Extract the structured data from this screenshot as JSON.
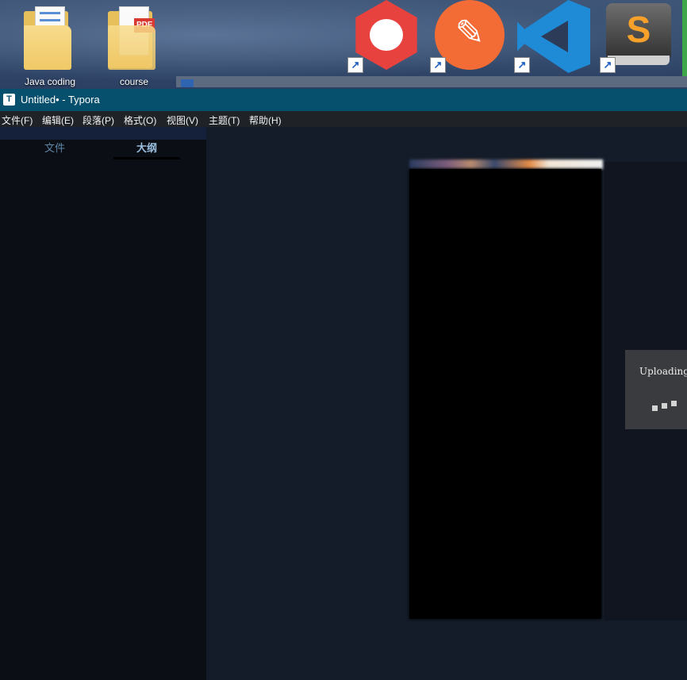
{
  "desktop": {
    "icons": [
      {
        "label": "Java coding"
      },
      {
        "label": "course",
        "badge": "PDF"
      }
    ],
    "apps": [
      "a-hexagon-app-icon",
      "postman-icon",
      "vscode-icon",
      "sublime-text-icon"
    ]
  },
  "window": {
    "app_icon": "T",
    "title": "Untitled• - Typora"
  },
  "menu": [
    "文件(F)",
    "编辑(E)",
    "段落(P)",
    "格式(O)",
    "视图(V)",
    "主题(T)",
    "帮助(H)"
  ],
  "sidebar": {
    "tabs": [
      {
        "label": "文件",
        "active": false
      },
      {
        "label": "大纲",
        "active": true
      }
    ]
  },
  "upload": {
    "text": "Uploading"
  },
  "colors": {
    "titlebar": "#06506e",
    "menubar": "#1f2226",
    "sidebar": "#0b0e14",
    "editor": "#141c29",
    "toast": "#3a3b3e"
  }
}
